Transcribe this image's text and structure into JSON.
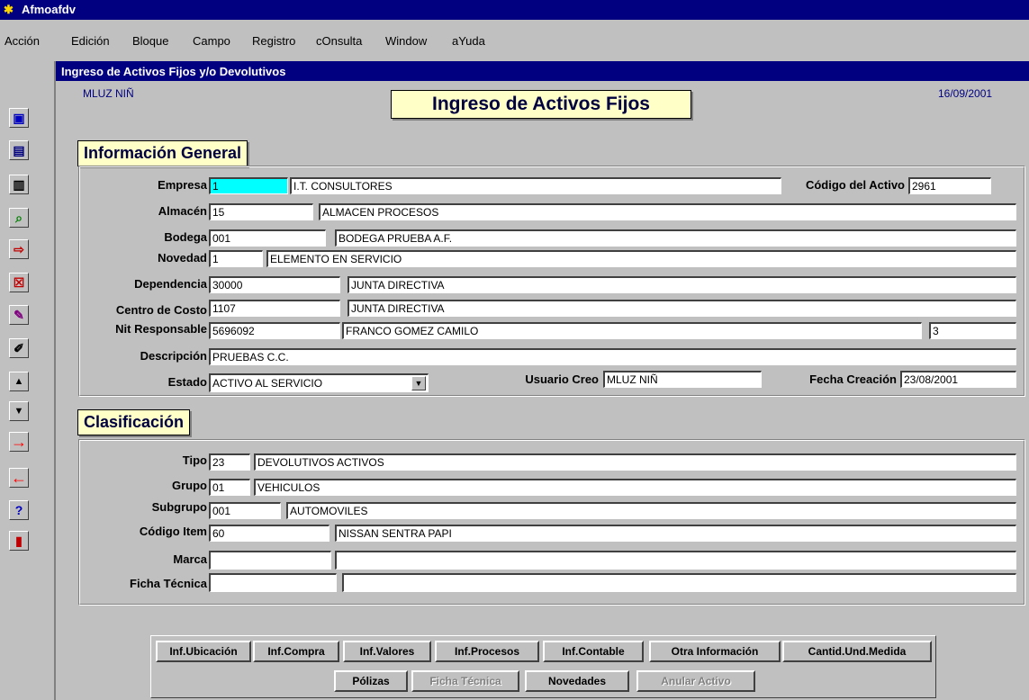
{
  "window": {
    "title": "Afmoafdv"
  },
  "menu": [
    "Acción",
    "Edición",
    "Bloque",
    "Campo",
    "Registro",
    "cOnsulta",
    "Window",
    "aYuda"
  ],
  "form": {
    "title": "Ingreso de Activos Fijos y/o Devolutivos",
    "user": "MLUZ NIÑ",
    "date": "16/09/2001",
    "heading": "Ingreso de Activos Fijos"
  },
  "sidebar_icons": [
    "save-icon",
    "form-icon",
    "clipboard-icon",
    "query-icon",
    "insert-record-icon",
    "delete-record-icon",
    "clear-icon",
    "edit-icon",
    "up-arrow-icon",
    "down-arrow-icon",
    "next-arrow-icon",
    "prev-arrow-icon",
    "help-icon",
    "exit-icon"
  ],
  "general": {
    "title": "Información General",
    "empresa": {
      "label": "Empresa",
      "code": "1",
      "name": "I.T. CONSULTORES"
    },
    "codigo_activo": {
      "label": "Código del Activo",
      "value": "2961"
    },
    "almacen": {
      "label": "Almacén",
      "code": "15",
      "name": "ALMACEN PROCESOS"
    },
    "bodega": {
      "label": "Bodega",
      "code": "001",
      "name": "BODEGA PRUEBA A.F."
    },
    "novedad": {
      "label": "Novedad",
      "code": "1",
      "name": "ELEMENTO EN SERVICIO"
    },
    "dependencia": {
      "label": "Dependencia",
      "code": "30000",
      "name": "JUNTA DIRECTIVA"
    },
    "centro_costo": {
      "label": "Centro de Costo",
      "code": "1107",
      "name": "JUNTA DIRECTIVA"
    },
    "nit": {
      "label": "Nit Responsable",
      "code": "5696092",
      "name": "FRANCO GOMEZ CAMILO",
      "extra": "3"
    },
    "descripcion": {
      "label": "Descripción",
      "value": "PRUEBAS C.C."
    },
    "estado": {
      "label": "Estado",
      "value": "ACTIVO AL SERVICIO"
    },
    "usuario": {
      "label": "Usuario Creo",
      "value": "MLUZ NIÑ"
    },
    "fecha": {
      "label": "Fecha Creación",
      "value": "23/08/2001"
    }
  },
  "clasificacion": {
    "title": "Clasificación",
    "tipo": {
      "label": "Tipo",
      "code": "23",
      "name": "DEVOLUTIVOS ACTIVOS"
    },
    "grupo": {
      "label": "Grupo",
      "code": "01",
      "name": "VEHICULOS"
    },
    "subgrupo": {
      "label": "Subgrupo",
      "code": "001",
      "name": "AUTOMOVILES"
    },
    "item": {
      "label": "Código Item",
      "code": "60",
      "name": "NISSAN SENTRA PAPI"
    },
    "marca": {
      "label": "Marca",
      "code": "",
      "name": ""
    },
    "ficha": {
      "label": "Ficha Técnica",
      "code": "",
      "name": ""
    }
  },
  "buttons": {
    "ubicacion": "Inf.Ubicación",
    "compra": "Inf.Compra",
    "valores": "Inf.Valores",
    "procesos": "Inf.Procesos",
    "contable": "Inf.Contable",
    "otra": "Otra Información",
    "cantid": "Cantid.Und.Medida",
    "polizas": "Pólizas",
    "ficha": "Ficha Técnica",
    "novedades": "Novedades",
    "anular": "Anular Activo"
  }
}
